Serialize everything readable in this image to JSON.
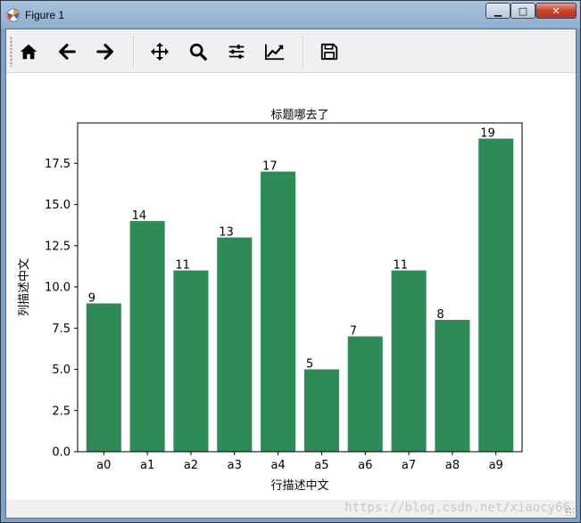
{
  "window": {
    "title": "Figure 1",
    "minimize": "▁",
    "maximize": "□",
    "close": "✕"
  },
  "toolbar": {
    "items": [
      {
        "name": "home",
        "icon": "home-icon"
      },
      {
        "name": "back",
        "icon": "arrow-left-icon"
      },
      {
        "name": "forward",
        "icon": "arrow-right-icon"
      },
      {
        "name": "pan",
        "icon": "move-icon"
      },
      {
        "name": "zoom",
        "icon": "search-icon"
      },
      {
        "name": "subplots",
        "icon": "sliders-icon"
      },
      {
        "name": "axes",
        "icon": "line-chart-icon"
      },
      {
        "name": "save",
        "icon": "save-icon"
      }
    ]
  },
  "status": {
    "watermark": "https://blog.csdn.net/xiaocy66"
  },
  "colors": {
    "bar": "#2e8b57"
  },
  "chart_data": {
    "type": "bar",
    "title": "标题哪去了",
    "xlabel": "行描述中文",
    "ylabel": "列描述中文",
    "categories": [
      "a0",
      "a1",
      "a2",
      "a3",
      "a4",
      "a5",
      "a6",
      "a7",
      "a8",
      "a9"
    ],
    "values": [
      9,
      14,
      11,
      13,
      17,
      5,
      7,
      11,
      8,
      19
    ],
    "ylim": [
      0,
      19.95
    ],
    "yticks": [
      "0.0",
      "2.5",
      "5.0",
      "7.5",
      "10.0",
      "12.5",
      "15.0",
      "17.5"
    ],
    "ytick_values": [
      0,
      2.5,
      5,
      7.5,
      10,
      12.5,
      15,
      17.5
    ],
    "data_labels": [
      "9",
      "14",
      "11",
      "13",
      "17",
      "5",
      "7",
      "11",
      "8",
      "19"
    ],
    "grid": false,
    "legend": "none"
  }
}
